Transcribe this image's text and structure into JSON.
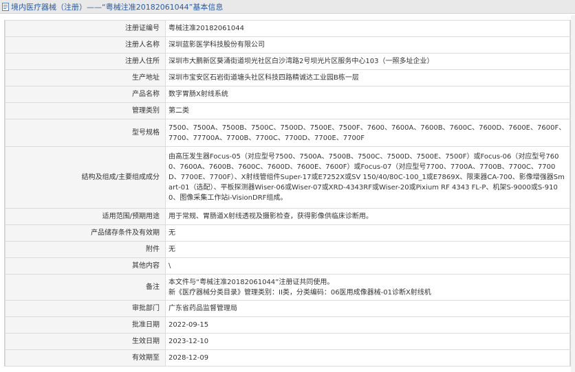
{
  "header": {
    "title": "境内医疗器械（注册）——“粤械注准20182061044”基本信息"
  },
  "rows": [
    {
      "label": "注册证编号",
      "value": [
        "粤械注准20182061044"
      ]
    },
    {
      "label": "注册人名称",
      "value": [
        "深圳蓝影医学科技股份有限公司"
      ]
    },
    {
      "label": "注册人住所",
      "value": [
        "深圳市大鹏新区葵涌街道坝光社区白沙湾路2号坝光片区服务中心103（一照多址企业）"
      ]
    },
    {
      "label": "生产地址",
      "value": [
        "深圳市宝安区石岩街道塘头社区科技四路精诚达工业园B栋一层"
      ]
    },
    {
      "label": "产品名称",
      "value": [
        "数字胃肠X射线系统"
      ]
    },
    {
      "label": "管理类别",
      "value": [
        "第二类"
      ]
    },
    {
      "label": "型号规格",
      "value": [
        "7500、7500A、7500B、7500C、7500D、7500E、7500F、7600、7600A、7600B、7600C、7600D、7600E、7600F、7700、77700A、7700B、7700C、7700D、7700E、7700F"
      ]
    },
    {
      "label": "结构及组成/主要组成成分",
      "value": [
        "由高压发生器Focus-05（对应型号7500、7500A、7500B、7500C、7500D、7500E、7500F）或Focus-06（对应型号7600、7600A、7600B、7600C、7600D、7600E、7600F）或Focus-07（对应型号7700、7700A、7700B、7700C、7700D、7700E、7700F）、X射线管组件Super-17或E7252X或SV 150/40/80C-100_1或E7869X、限束器CA-700、影像增强器Smart-01（选配）、平板探测器Wiser-06或Wiser-07或XRD-4343RF或Wiser-20或Pixium RF 4343 FL-P、机架S-9000或S-9100、图像采集工作站i-VisionDRF组成。"
      ]
    },
    {
      "label": "适用范围/预期用途",
      "value": [
        "用于常规、胃肠道X射线透视及摄影检查，获得影像供临床诊断用。"
      ]
    },
    {
      "label": "产品储存条件及有效期",
      "value": [
        "无"
      ]
    },
    {
      "label": "附件",
      "value": [
        "无"
      ]
    },
    {
      "label": "其他内容",
      "value": [
        "\\"
      ]
    },
    {
      "label": "备注",
      "value": [
        "本文件与“粤械注准20182061044”注册证共同使用。",
        "新《医疗器械分类目录》管理类别：II类，分类编码：06医用成像器械-01诊断X射线机"
      ]
    },
    {
      "label": "审批部门",
      "value": [
        "广东省药品监督管理局"
      ]
    },
    {
      "label": "批准日期",
      "value": [
        "2022-09-15"
      ]
    },
    {
      "label": "生效日期",
      "value": [
        "2023-12-10"
      ]
    },
    {
      "label": "有效期至",
      "value": [
        "2028-12-09"
      ]
    }
  ]
}
